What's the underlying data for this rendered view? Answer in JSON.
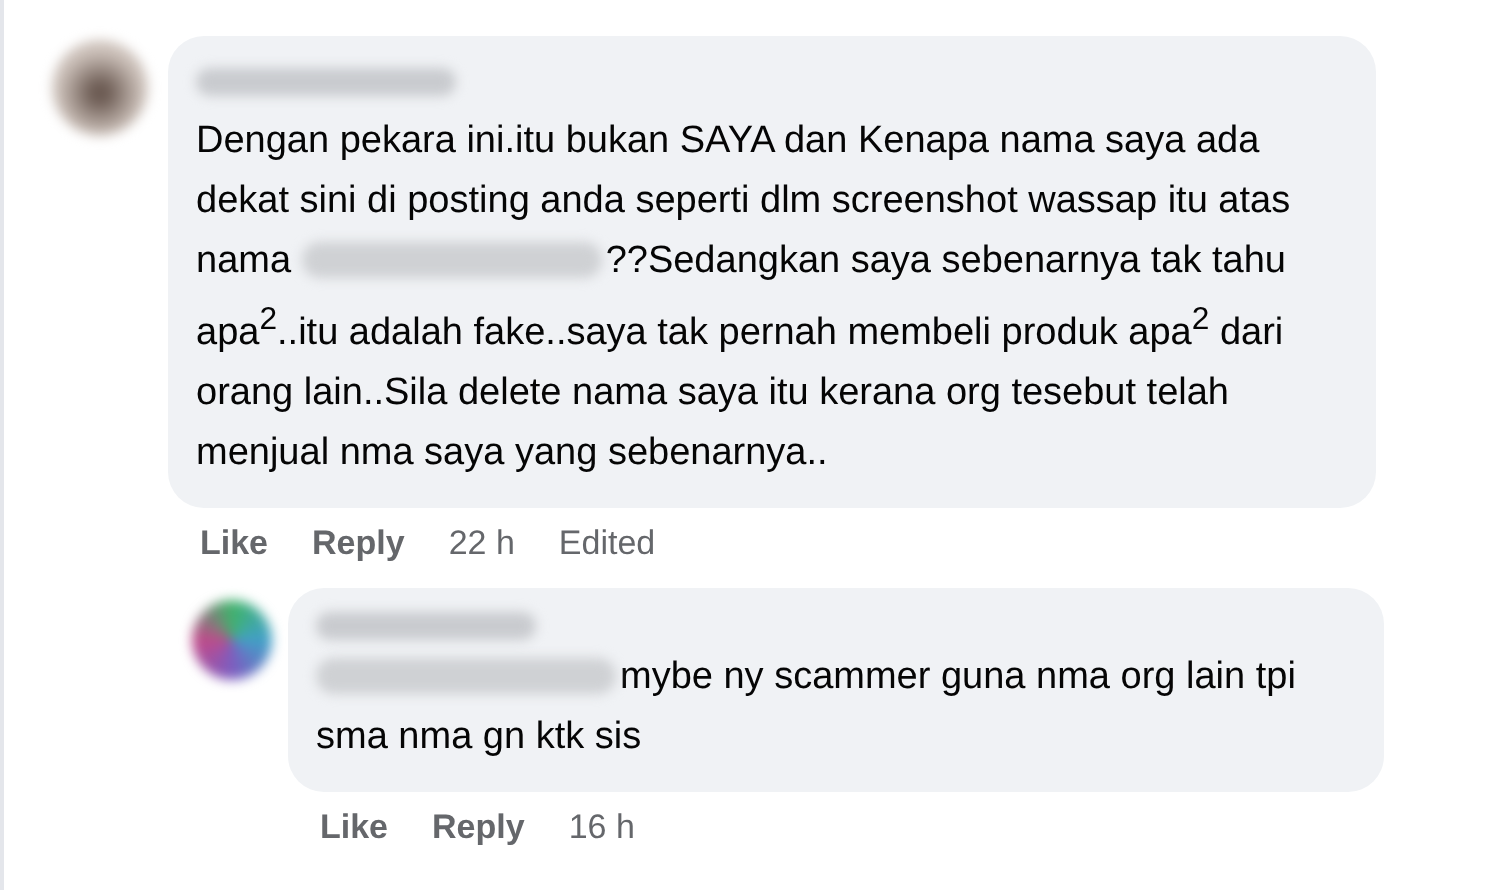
{
  "comments": [
    {
      "body": [
        {
          "kind": "text",
          "text": "Dengan pekara ini.itu bukan SAYA dan Kenapa nama saya ada dekat sini di posting anda seperti dlm screenshot wassap itu atas nama "
        },
        {
          "kind": "redacted"
        },
        {
          "kind": "text",
          "text": "??Sedangkan saya sebenarnya tak tahu apa$^{2}$..itu adalah fake..saya tak pernah membeli produk apa$^{2}$ dari orang lain..Sila delete nama saya itu kerana org tesebut telah menjual nma saya yang sebenarnya.."
        }
      ],
      "actions": {
        "like": "Like",
        "reply": "Reply",
        "time": "22 h",
        "edited": "Edited"
      },
      "replies": [
        {
          "body": [
            {
              "kind": "redacted"
            },
            {
              "kind": "text",
              "text": "mybe ny scammer guna nma org lain tpi sma nma gn ktk sis"
            }
          ],
          "actions": {
            "like": "Like",
            "reply": "Reply",
            "time": "16 h"
          }
        }
      ]
    }
  ]
}
